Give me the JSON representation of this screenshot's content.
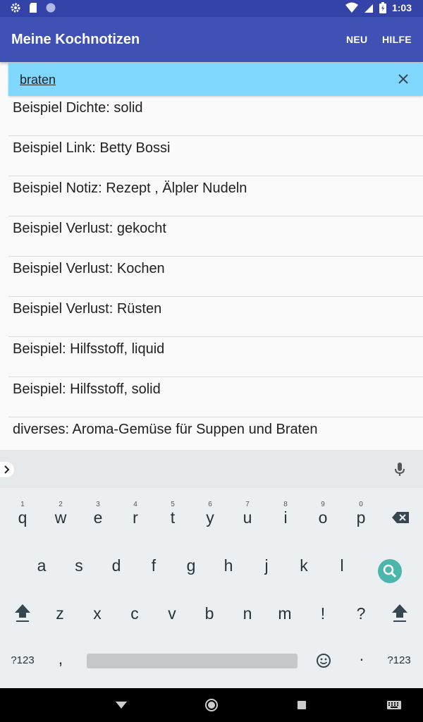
{
  "status_bar": {
    "time": "1:03"
  },
  "app_bar": {
    "title": "Meine Kochnotizen",
    "action_new": "NEU",
    "action_help": "HILFE"
  },
  "search": {
    "value": "braten"
  },
  "list": {
    "items": [
      "Beispiel Dichte: solid",
      "Beispiel Link: Betty Bossi",
      "Beispiel Notiz: Rezept , Älpler Nudeln",
      "Beispiel Verlust: gekocht",
      "Beispiel Verlust: Kochen",
      "Beispiel Verlust: Rüsten",
      "Beispiel: Hilfsstoff, liquid",
      "Beispiel: Hilfsstoff, solid",
      "diverses: Aroma-Gemüse für Suppen und Braten"
    ]
  },
  "keyboard": {
    "row1": [
      {
        "key": "q",
        "hint": "1"
      },
      {
        "key": "w",
        "hint": "2"
      },
      {
        "key": "e",
        "hint": "3"
      },
      {
        "key": "r",
        "hint": "4"
      },
      {
        "key": "t",
        "hint": "5"
      },
      {
        "key": "y",
        "hint": "6"
      },
      {
        "key": "u",
        "hint": "7"
      },
      {
        "key": "i",
        "hint": "8"
      },
      {
        "key": "o",
        "hint": "9"
      },
      {
        "key": "p",
        "hint": "0"
      }
    ],
    "row2": [
      "a",
      "s",
      "d",
      "f",
      "g",
      "h",
      "j",
      "k",
      "l"
    ],
    "row3": [
      "z",
      "x",
      "c",
      "v",
      "b",
      "n",
      "m",
      "!",
      "?"
    ],
    "symbols_left": "?123",
    "comma": ",",
    "period": "·",
    "symbols_right": "?123"
  },
  "colors": {
    "primary": "#3f51b5",
    "primary_dark": "#3343a8",
    "search_bg": "#80d8ff",
    "accent": "#4db6ac"
  }
}
